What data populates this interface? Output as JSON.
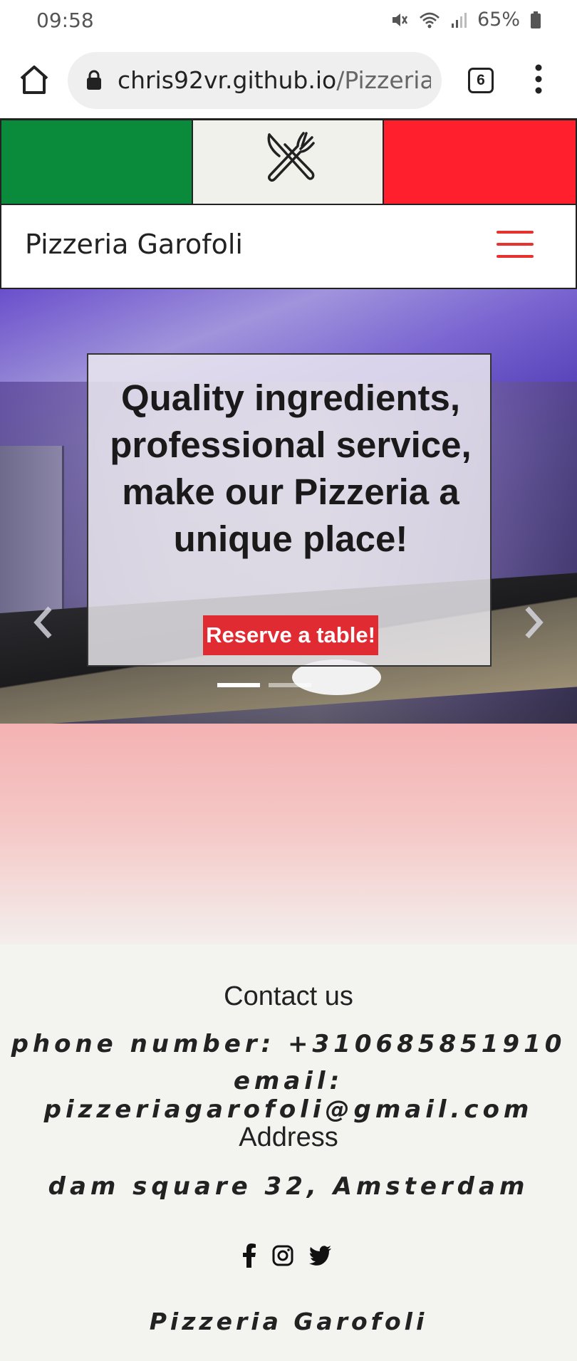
{
  "status_bar": {
    "time": "09:58",
    "battery": "65%"
  },
  "browser": {
    "url_host": "chris92vr.github.io",
    "url_path": "/Pizzeria-G",
    "tab_count": "6"
  },
  "colors": {
    "flag_green": "#0a8a3b",
    "flag_white": "#f1f1ec",
    "flag_red": "#ff1f2d",
    "accent": "#e02b33"
  },
  "navbar": {
    "brand": "Pizzeria Garofoli",
    "menu_icon": "hamburger-icon"
  },
  "hero": {
    "title": "Quality ingredients, professional service, make our Pizzeria a unique place!",
    "button_label": "Reserve a table!",
    "slides": 2,
    "active_slide": 1
  },
  "contact": {
    "title": "Contact us",
    "phone": "phone number: +310685851910",
    "email": "email: pizzeriagarofoli@gmail.com",
    "address_title": "Address",
    "address": "dam square 32, Amsterdam",
    "social_icons": [
      "facebook-icon",
      "instagram-icon",
      "twitter-icon"
    ],
    "footer_brand": "Pizzeria Garofoli"
  }
}
